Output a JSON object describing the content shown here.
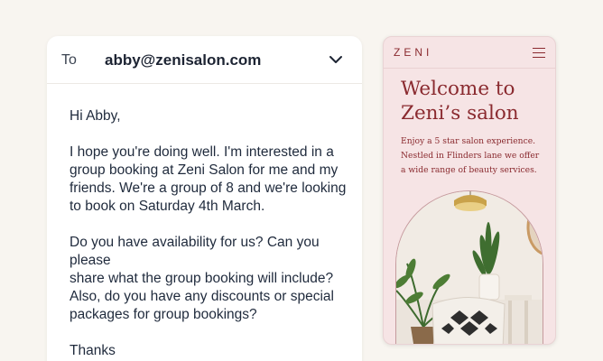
{
  "email": {
    "to_label": "To",
    "to_address": "abby@zenisalon.com",
    "chevron_icon": "chevron-down-icon",
    "body_lines": [
      [
        "Hi Abby,"
      ],
      [
        "I hope you're doing well. I'm interested in a",
        "group booking at Zeni Salon for me and my",
        "friends. We're a group of 8 and we're looking",
        "to book on Saturday 4th March."
      ],
      [
        "Do you have availability for us? Can you please",
        "share what the group booking will include?",
        "Also, do you have any discounts or special",
        "packages for group bookings?"
      ],
      [
        "Thanks"
      ]
    ]
  },
  "phone": {
    "logo": "ZENI",
    "menu_icon": "hamburger-menu-icon",
    "title_lines": [
      "Welcome to",
      "Zeni’s salon"
    ],
    "subtitle_lines": [
      "Enjoy a 5 star salon experience.",
      "Nestled in Flinders lane we offer",
      "a wide range of beauty services."
    ],
    "hero_image": "salon-interior-photo"
  },
  "colors": {
    "page_background": "#f8f5f0",
    "email_card": "#ffffff",
    "email_text": "#1f2a3c",
    "phone_background": "#f6e4e5",
    "brand_accent": "#8a2a2f"
  }
}
